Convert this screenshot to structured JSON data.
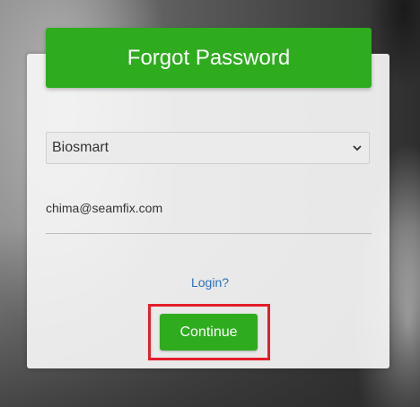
{
  "header": {
    "title": "Forgot Password"
  },
  "form": {
    "organization_select": {
      "value": "Biosmart"
    },
    "email_field": {
      "value": "chima@seamfix.com"
    },
    "login_link": "Login?",
    "continue_label": "Continue"
  },
  "icons": {
    "select_arrow": "chevron-down-icon"
  },
  "colors": {
    "primary": "#2eac1e",
    "link": "#2c6fbf",
    "highlight": "#e31e2a"
  }
}
